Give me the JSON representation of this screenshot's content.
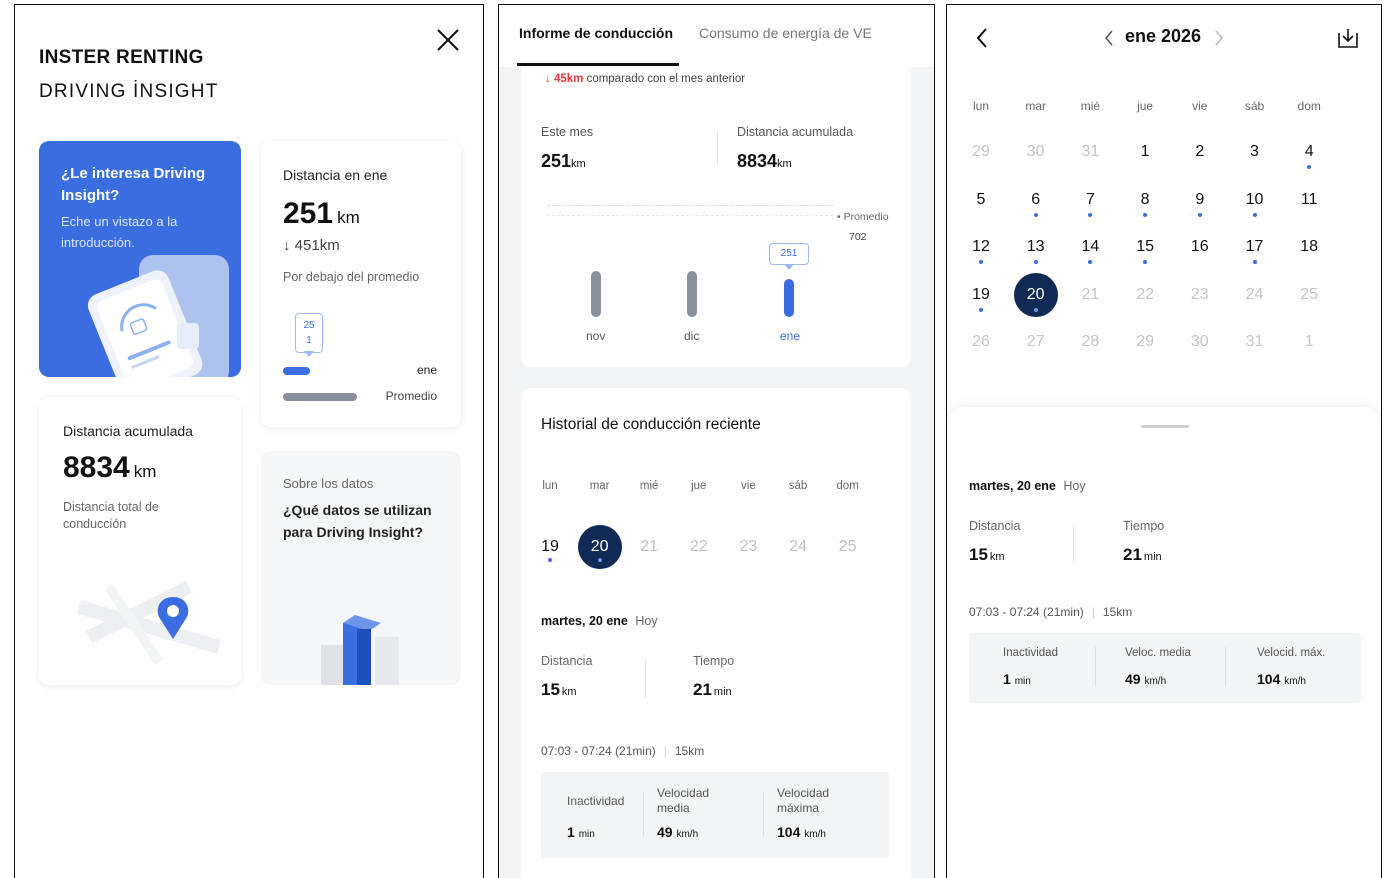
{
  "panel1": {
    "title_line1": "INSTER RENTING",
    "title_line2": "DRIVING İNSIGHT",
    "intro_card": {
      "title": "¿Le interesa Driving Insight?",
      "subtitle": "Eche un vistazo a la introducción."
    },
    "distance_card": {
      "label": "Distancia en ene",
      "value": "251",
      "unit": "km",
      "delta": "↓ 451km",
      "note": "Por debajo del promedio",
      "bubble": "25\n1",
      "bar1_label": "ene",
      "bar2_label": "Promedio",
      "bar1_fraction": 0.36,
      "bar2_fraction": 1.0
    },
    "accumulated_card": {
      "label": "Distancia acumulada",
      "value": "8834",
      "unit": "km",
      "note": "Distancia total de conducción"
    },
    "data_card": {
      "eyebrow": "Sobre los datos",
      "title": "¿Qué datos se utilizan para Driving Insight?"
    },
    "colors": {
      "accent": "#3a6ee0",
      "bar_grey": "#8a9099"
    }
  },
  "panel2": {
    "tabs": [
      "Informe de conducción",
      "Consumo de energía de VE"
    ],
    "compare_value": "↓ 45km",
    "compare_text": "comparado con el mes anterior",
    "this_month_label": "Este mes",
    "this_month_value": "251",
    "this_month_unit": "km",
    "accum_label": "Distancia acumulada",
    "accum_value": "8834",
    "accum_unit": "km",
    "avg_label": "Promedio",
    "avg_value": "702",
    "chart_bubble": "251",
    "chart_months": [
      "nov",
      "dic",
      "ene"
    ],
    "history_title": "Historial de conducción reciente",
    "weekdays": [
      "lun",
      "mar",
      "mié",
      "jue",
      "vie",
      "sáb",
      "dom"
    ],
    "week_days": [
      "19",
      "20",
      "21",
      "22",
      "23",
      "24",
      "25"
    ],
    "day_title": "martes, 20 ene",
    "today": "Hoy",
    "distance_label": "Distancia",
    "distance_value": "15",
    "distance_unit": "km",
    "time_label": "Tiempo",
    "time_value": "21",
    "time_unit": "min",
    "trip_time": "07:03 - 07:24 (21min)",
    "trip_km": "15km",
    "stat1_label": "Inactividad",
    "stat1_value": "1",
    "stat1_unit": "min",
    "stat2_label_1": "Velocidad",
    "stat2_label_2": "media",
    "stat2_value": "49",
    "stat2_unit": "km/h",
    "stat3_label_1": "Velocidad",
    "stat3_label_2": "máxima",
    "stat3_value": "104",
    "stat3_unit": "km/h"
  },
  "panel3": {
    "month_title": "ene 2026",
    "weekdays": [
      "lun",
      "mar",
      "mié",
      "jue",
      "vie",
      "sáb",
      "dom"
    ],
    "weeks": [
      [
        "29",
        "30",
        "31",
        "1",
        "2",
        "3",
        "4"
      ],
      [
        "5",
        "6",
        "7",
        "8",
        "9",
        "10",
        "11"
      ],
      [
        "12",
        "13",
        "14",
        "15",
        "16",
        "17",
        "18"
      ],
      [
        "19",
        "20",
        "21",
        "22",
        "23",
        "24",
        "25"
      ],
      [
        "26",
        "27",
        "28",
        "29",
        "30",
        "31",
        "1"
      ]
    ],
    "day_title": "martes, 20 ene",
    "today": "Hoy",
    "distance_label": "Distancia",
    "distance_value": "15",
    "distance_unit": "km",
    "time_label": "Tiempo",
    "time_value": "21",
    "time_unit": "min",
    "trip_time": "07:03 - 07:24 (21min)",
    "trip_km": "15km",
    "stat1_label": "Inactividad",
    "stat1_value": "1",
    "stat1_unit": "min",
    "stat2_label": "Veloc. media",
    "stat2_value": "49",
    "stat2_unit": "km/h",
    "stat3_label": "Velocid. máx.",
    "stat3_value": "104",
    "stat3_unit": "km/h"
  }
}
